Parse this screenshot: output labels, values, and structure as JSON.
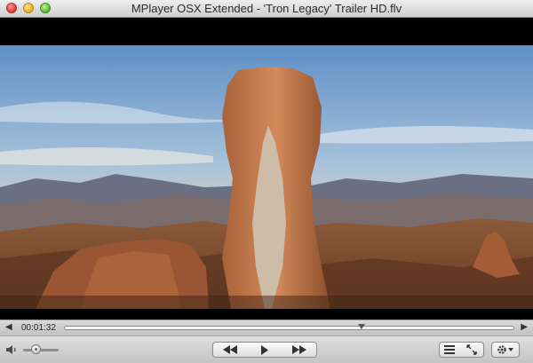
{
  "window": {
    "title": "MPlayer OSX Extended - 'Tron Legacy' Trailer HD.flv"
  },
  "playback": {
    "current_time": "00:01:32",
    "progress": 0.66
  },
  "volume": {
    "level": 0.35
  },
  "icons": {
    "seek_back": "triangle-left-icon",
    "seek_forward": "triangle-right-icon",
    "rewind": "rewind-icon",
    "play": "play-icon",
    "fast_forward": "fast-forward-icon",
    "playlist": "playlist-icon",
    "fullscreen": "fullscreen-icon",
    "settings": "gear-icon",
    "volume": "speaker-icon"
  },
  "colors": {
    "close": "#e0443a",
    "minimize": "#f2b32a",
    "zoom": "#63c33b"
  }
}
